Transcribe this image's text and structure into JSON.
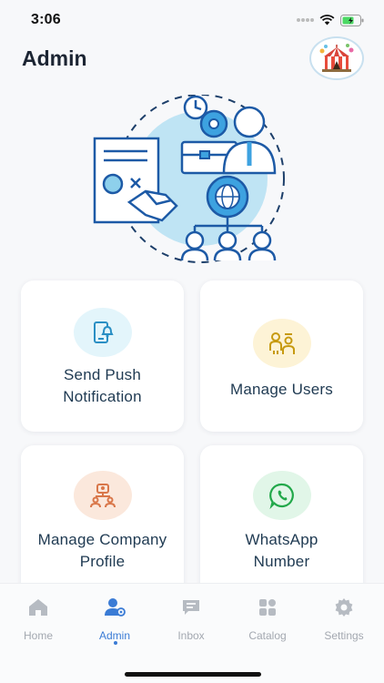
{
  "status_bar": {
    "time": "3:06"
  },
  "header": {
    "title": "Admin"
  },
  "cards": [
    {
      "label": "Send Push Notification",
      "icon": "notification-icon",
      "accent": "#e3f5fb"
    },
    {
      "label": "Manage Users",
      "icon": "users-icon",
      "accent": "#fdf3d6"
    },
    {
      "label": "Manage Company Profile",
      "icon": "company-profile-icon",
      "accent": "#fbe8dc"
    },
    {
      "label": "WhatsApp Number",
      "icon": "whatsapp-icon",
      "accent": "#e1f6e8"
    }
  ],
  "tabs": [
    {
      "label": "Home",
      "icon": "home-icon",
      "active": false
    },
    {
      "label": "Admin",
      "icon": "admin-icon",
      "active": true
    },
    {
      "label": "Inbox",
      "icon": "inbox-icon",
      "active": false
    },
    {
      "label": "Catalog",
      "icon": "catalog-icon",
      "active": false
    },
    {
      "label": "Settings",
      "icon": "settings-icon",
      "active": false
    }
  ],
  "colors": {
    "accent": "#3a7bd5",
    "card_text": "#1f3a52",
    "tab_inactive": "#a3a8b0"
  }
}
